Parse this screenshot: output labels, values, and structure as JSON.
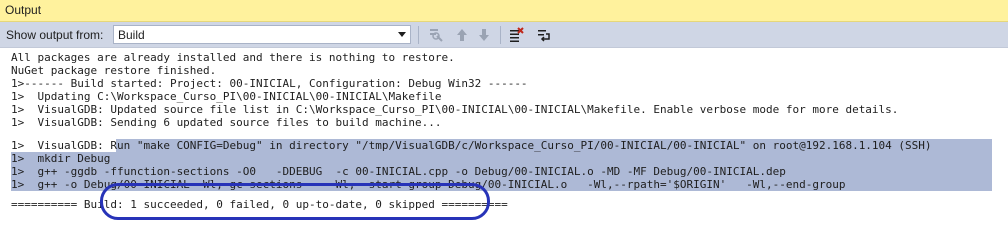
{
  "window": {
    "title": "Output"
  },
  "toolbar": {
    "show_output_label": "Show output from:",
    "source_value": "Build",
    "icons": [
      "find-message-icon",
      "go-prev-icon",
      "go-next-icon",
      "clear-all-icon",
      "toggle-word-wrap-icon"
    ]
  },
  "output": {
    "lines": [
      "All packages are already installed and there is nothing to restore.",
      "NuGet package restore finished.",
      "1>------ Build started: Project: 00-INICIAL, Configuration: Debug Win32 ------",
      "1>  Updating C:\\Workspace_Curso_PI\\00-INICIAL\\00-INICIAL\\Makefile",
      "1>  VisualGDB: Updated source file list in C:\\Workspace_Curso_PI\\00-INICIAL\\00-INICIAL\\Makefile. Enable verbose mode for more details.",
      "1>  VisualGDB: Sending 6 updated source files to build machine...",
      "1>  VisualGDB: Run \"make CONFIG=Debug\" in directory \"/tmp/VisualGDB/c/Workspace_Curso_PI/00-INICIAL/00-INICIAL\" on root@192.168.1.104 (SSH)",
      "1>  mkdir Debug",
      "1>  g++ -ggdb -ffunction-sections -O0   -DDEBUG  -c 00-INICIAL.cpp -o Debug/00-INICIAL.o -MD -MF Debug/00-INICIAL.dep",
      "1>  g++ -o Debug/00-INICIAL -Wl,-gc-sections    -Wl,--start-group Debug/00-INICIAL.o   -Wl,--rpath='$ORIGIN'   -Wl,--end-group",
      "========== Build: 1 succeeded, 0 failed, 0 up-to-date, 0 skipped =========="
    ]
  },
  "colors": {
    "title_bg": "#fff29d",
    "toolbar_bg": "#cfd6e5",
    "selection": "#adb9d6",
    "annotation": "#2733b8"
  }
}
